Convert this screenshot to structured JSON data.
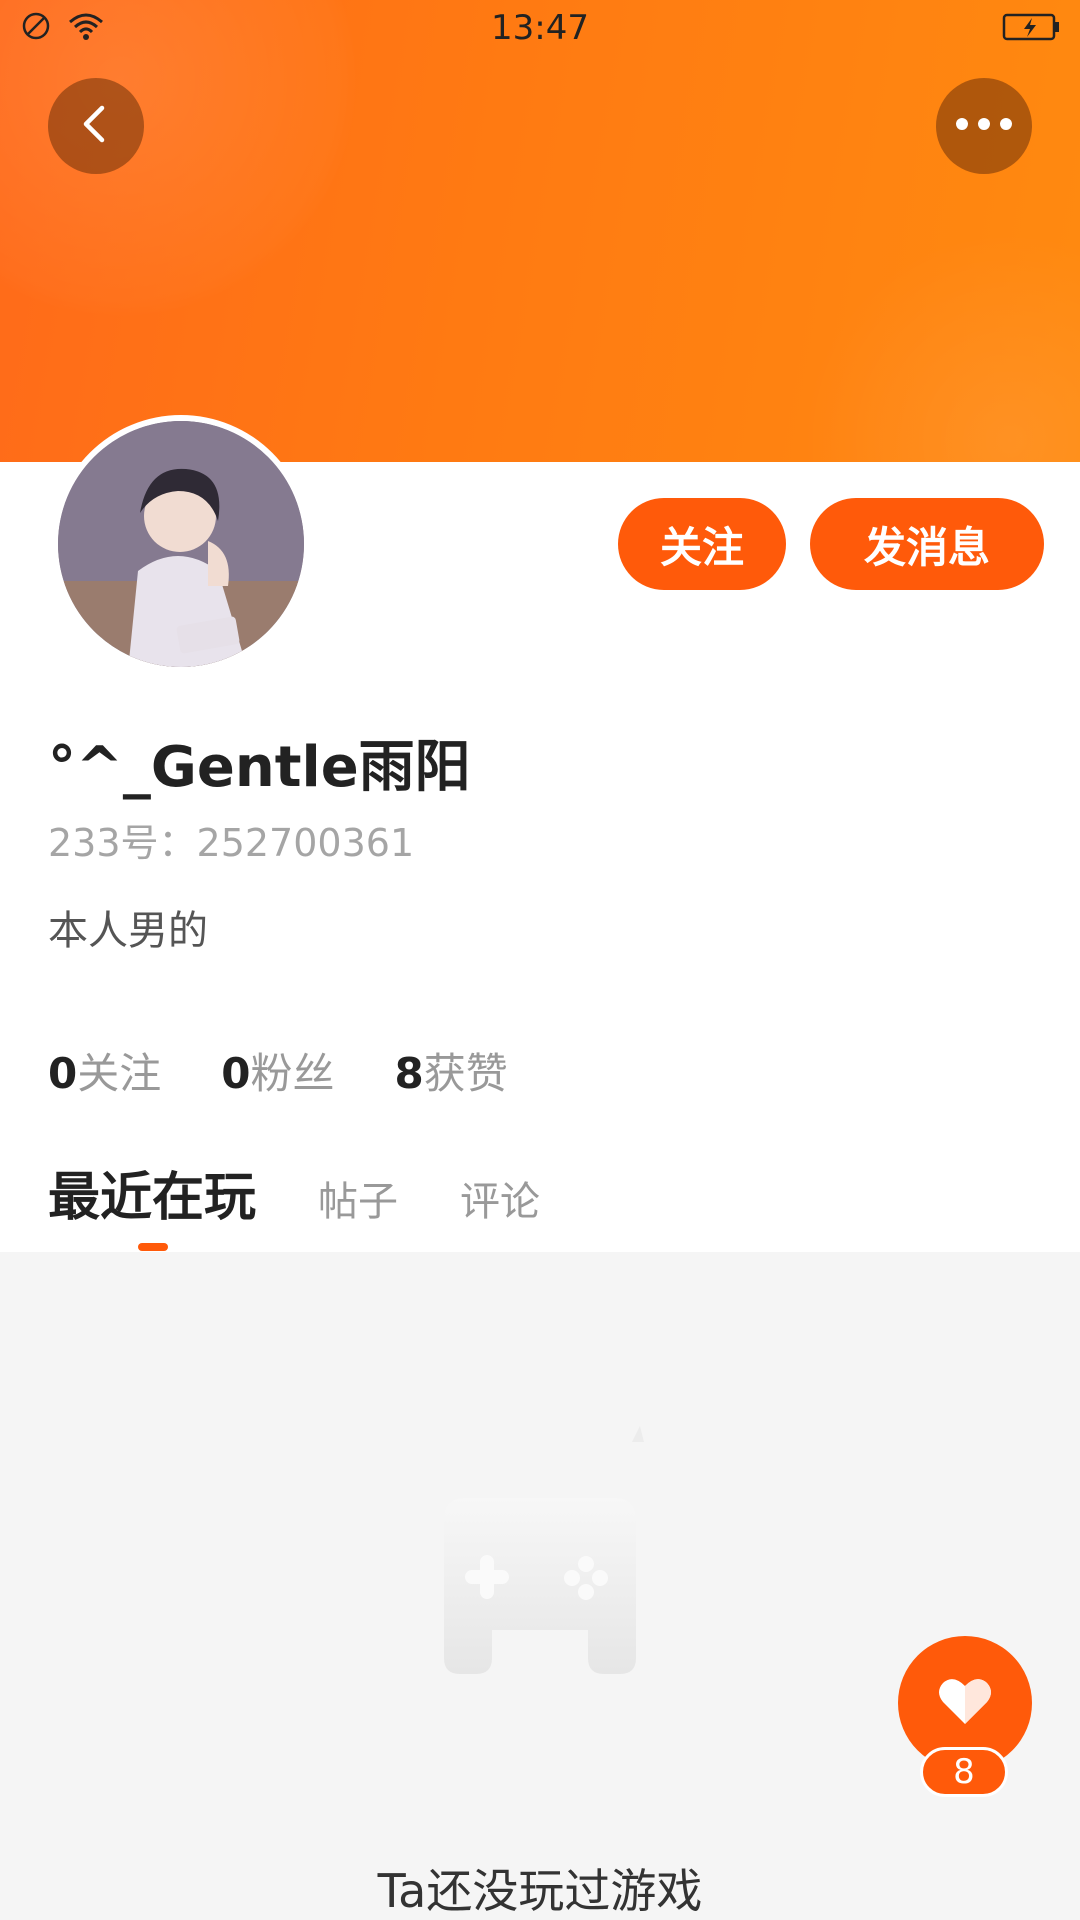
{
  "status_bar": {
    "time": "13:47"
  },
  "profile": {
    "nickname": "°^_Gentle雨阳",
    "id_text": "233号：252700361",
    "bio": "本人男的"
  },
  "actions": {
    "follow_label": "关注",
    "message_label": "发消息"
  },
  "stats": [
    {
      "count": "0",
      "label": "关注"
    },
    {
      "count": "0",
      "label": "粉丝"
    },
    {
      "count": "8",
      "label": "获赞"
    }
  ],
  "tabs": [
    {
      "label": "最近在玩",
      "active": true
    },
    {
      "label": "帖子",
      "active": false
    },
    {
      "label": "评论",
      "active": false
    }
  ],
  "empty_state": {
    "message": "Ta还没玩过游戏"
  },
  "like_fab": {
    "count": "8"
  },
  "colors": {
    "accent": "#ff5a0a",
    "header_gradient_start": "#ff6a1a",
    "header_gradient_end": "#ff8a10"
  }
}
